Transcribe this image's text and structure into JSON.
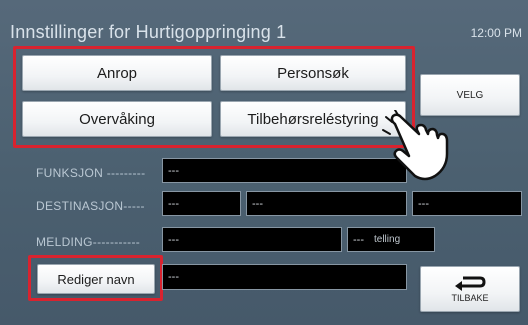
{
  "header": {
    "title": "Innstillinger for Hurtigoppringing 1",
    "time": "12:00 PM"
  },
  "buttons": {
    "call": "Anrop",
    "paging": "Personsøk",
    "monitoring": "Overvåking",
    "relay_control": "Tilbehørsreléstyring",
    "select": "VELG",
    "edit_name": "Rediger navn",
    "back": "TILBAKE"
  },
  "fields": {
    "function": {
      "label": "FUNKSJON ---------",
      "value": "---"
    },
    "destination": {
      "label": "DESTINASJON-----",
      "values": [
        "---",
        "---",
        "---"
      ]
    },
    "message": {
      "label": "MELDING-----------",
      "value": "---",
      "count_value": "---",
      "count_unit": "telling"
    },
    "name": {
      "value": "---"
    }
  },
  "colors": {
    "highlight": "#d9232f",
    "background": "#4e6373"
  },
  "icons": {
    "back": "return-arrow-icon",
    "pointer": "pointing-hand-icon"
  }
}
